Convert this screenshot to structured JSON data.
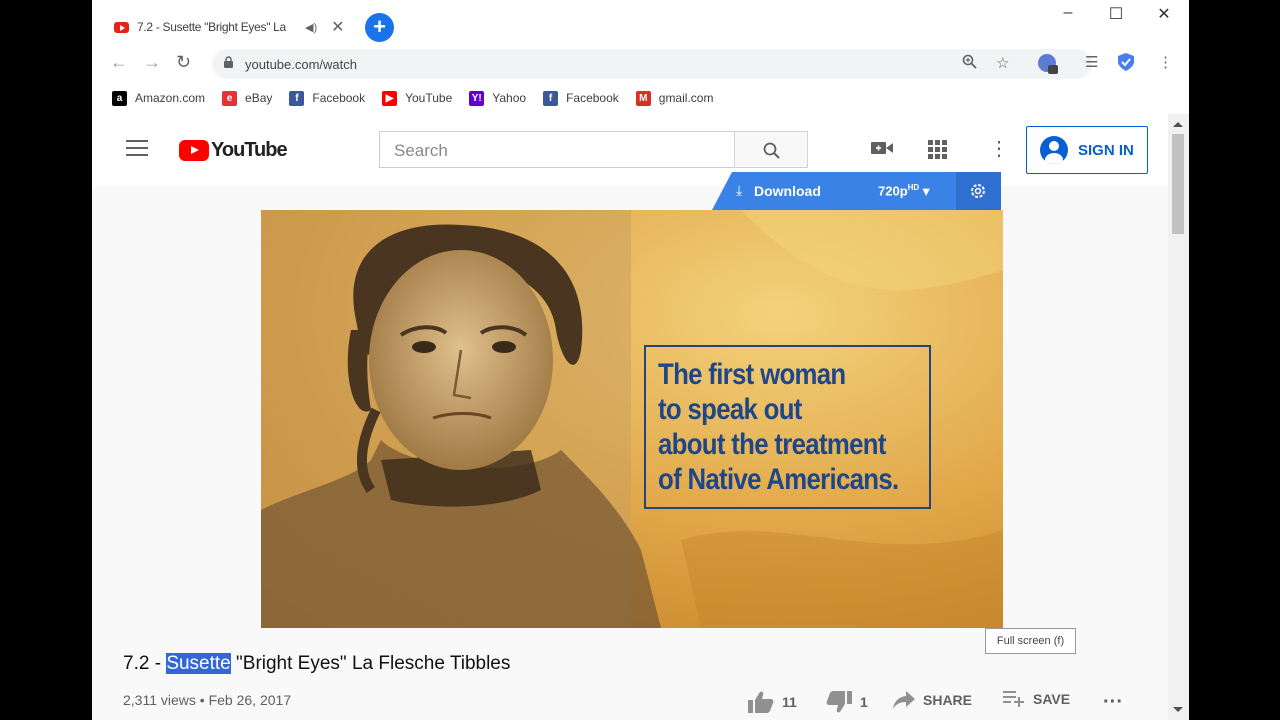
{
  "browser": {
    "tab_title": "7.2 - Susette \"Bright Eyes\" La",
    "tab_audio_icon": "speaker-icon",
    "url": "youtube.com/watch",
    "window_controls": {
      "minimize": "–",
      "maximize": "☐",
      "close": "✕"
    },
    "bookmarks": [
      {
        "label": "Amazon.com",
        "icon": "amazon-icon",
        "glyph": "a",
        "color": "#000000"
      },
      {
        "label": "eBay",
        "icon": "ebay-icon",
        "glyph": "e",
        "color": "#e53238"
      },
      {
        "label": "Facebook",
        "icon": "facebook-icon",
        "glyph": "f",
        "color": "#3b5998"
      },
      {
        "label": "YouTube",
        "icon": "youtube-icon",
        "glyph": "▶",
        "color": "#ff0000"
      },
      {
        "label": "Yahoo",
        "icon": "yahoo-icon",
        "glyph": "Y!",
        "color": "#6001d2"
      },
      {
        "label": "Facebook",
        "icon": "facebook-icon",
        "glyph": "f",
        "color": "#3b5998"
      },
      {
        "label": "gmail.com",
        "icon": "gmail-icon",
        "glyph": "M",
        "color": "#d93025"
      }
    ]
  },
  "youtube": {
    "logo_text": "YouTube",
    "search_placeholder": "Search",
    "sign_in_label": "SIGN IN",
    "download_label": "Download",
    "quality_label": "720p",
    "quality_suffix": "HD",
    "video_overlay_lines": [
      "The first woman",
      "to speak out",
      "about the treatment",
      "of Native Americans."
    ],
    "fullscreen_tooltip": "Full screen (f)",
    "title_prefix": "7.2 - ",
    "title_highlight": "Susette",
    "title_rest": " \"Bright Eyes\" La Flesche Tibbles",
    "views": "2,311 views",
    "separator": " • ",
    "date": "Feb 26, 2017",
    "likes": "11",
    "dislikes": "1",
    "share_label": "SHARE",
    "save_label": "SAVE",
    "accent_color": "#065fd4",
    "brand_color": "#ff0000"
  }
}
